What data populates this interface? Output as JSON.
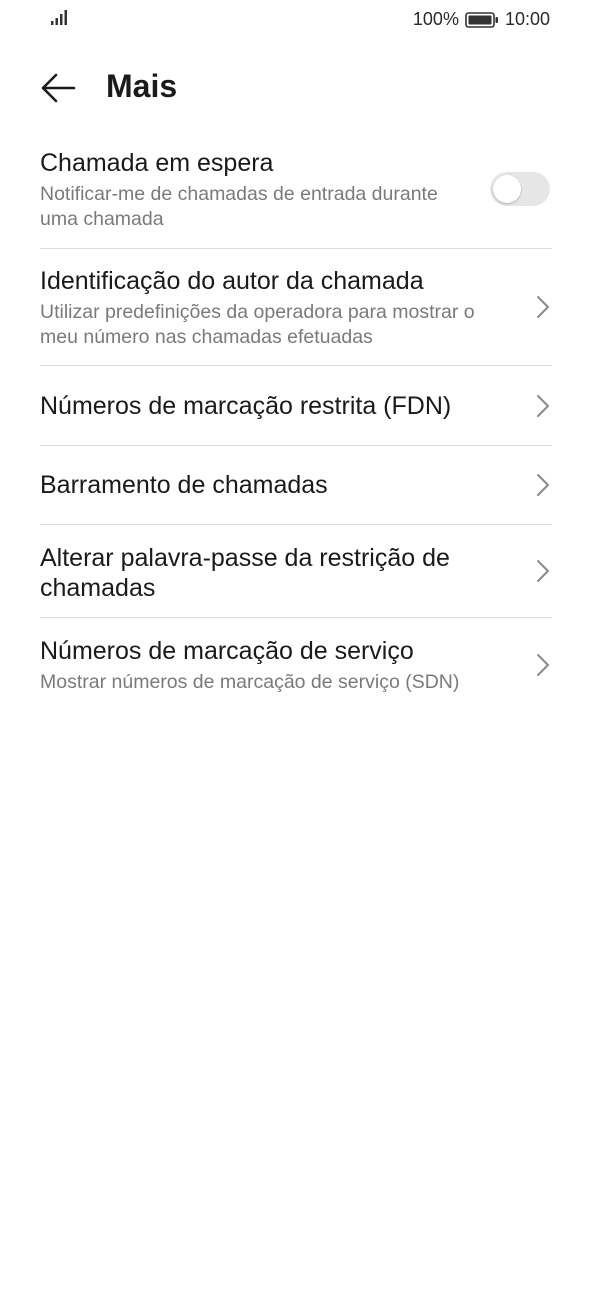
{
  "status_bar": {
    "battery_percent": "100%",
    "time": "10:00",
    "signal_icon": "signal-bars-icon",
    "battery_icon": "battery-icon"
  },
  "header": {
    "back_icon": "arrow-left-icon",
    "title": "Mais"
  },
  "items": [
    {
      "title": "Chamada em espera",
      "subtitle": "Notificar-me de chamadas de entrada durante uma chamada",
      "control": "toggle",
      "toggle_on": false
    },
    {
      "title": "Identificação do autor da chamada",
      "subtitle": "Utilizar predefinições da operadora para mostrar o meu número nas chamadas efetuadas",
      "control": "chevron"
    },
    {
      "title": "Números de marcação restrita (FDN)",
      "control": "chevron"
    },
    {
      "title": "Barramento de chamadas",
      "control": "chevron"
    },
    {
      "title": "Alterar palavra-passe da restrição de chamadas",
      "control": "chevron"
    },
    {
      "title": "Números de marcação de serviço",
      "subtitle": "Mostrar números de marcação de serviço (SDN)",
      "control": "chevron"
    }
  ],
  "colors": {
    "divider": "#dcdcdc",
    "subtitle": "#7a7a7a",
    "toggle_off_track": "#e6e6e6"
  }
}
